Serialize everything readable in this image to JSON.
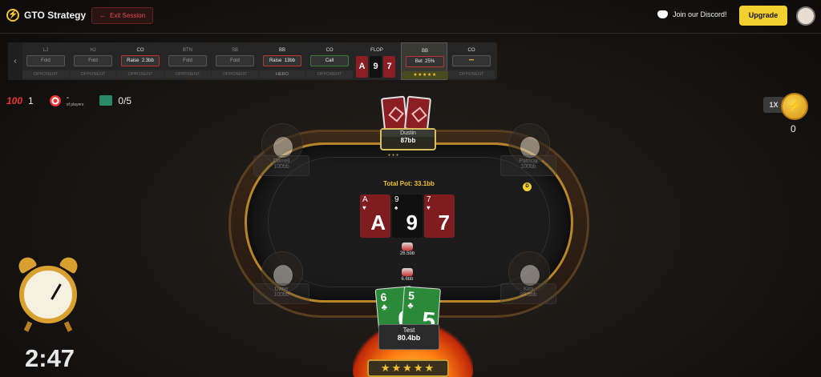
{
  "app": {
    "title": "GTO Strategy",
    "exit_label": "Exit Session",
    "discord_label": "Join our Discord!",
    "upgrade_label": "Upgrade",
    "accent_color": "#f2d030"
  },
  "timeline": {
    "columns": [
      {
        "pos": "LJ",
        "action": "Fold",
        "role": "OPPONENT"
      },
      {
        "pos": "HJ",
        "action": "Fold",
        "role": "OPPONENT"
      },
      {
        "pos": "CO",
        "action": "Raise",
        "amount": "2.3bb",
        "role": "OPPONENT"
      },
      {
        "pos": "BTN",
        "action": "Fold",
        "role": "OPPONENT"
      },
      {
        "pos": "SB",
        "action": "Fold",
        "role": "OPPONENT"
      },
      {
        "pos": "BB",
        "action": "Raise",
        "amount": "13bb",
        "role": "HERO"
      },
      {
        "pos": "CO",
        "action": "Call",
        "role": "OPPONENT"
      }
    ],
    "flop": {
      "label": "FLOP",
      "cards": [
        {
          "rank": "A",
          "suit": "♥"
        },
        {
          "rank": "9",
          "suit": "♠"
        },
        {
          "rank": "7",
          "suit": "♥"
        }
      ]
    },
    "selected": {
      "pos": "BB",
      "action": "Bet",
      "amount": "25%",
      "stars": "★★★★★"
    },
    "last": {
      "pos": "CO",
      "action": "•••",
      "role": "OPPONENT"
    }
  },
  "stats": {
    "score_icon": "100",
    "score": "1",
    "players_value": "-",
    "players_label": "of players",
    "hands": "0/5"
  },
  "coins": {
    "multiplier": "1X",
    "count": "0"
  },
  "table": {
    "pot_label": "Total Pot: 33.1bb",
    "board": [
      {
        "rank": "A",
        "suit": "♥",
        "color": "red"
      },
      {
        "rank": "9",
        "suit": "♠",
        "color": "black"
      },
      {
        "rank": "7",
        "suit": "♥",
        "color": "red"
      }
    ],
    "chips_top": "26.5bb",
    "chips_bottom": "6.6bb",
    "dealer": "D"
  },
  "seats": {
    "top": {
      "name": "Dustin",
      "stack": "87bb"
    },
    "top_left": {
      "name": "Darrell",
      "stack": "100bb"
    },
    "top_right": {
      "name": "Patricia",
      "stack": "100bb"
    },
    "bottom_left": {
      "name": "Dane",
      "stack": "100bb"
    },
    "bottom_right": {
      "name": "Kim",
      "stack": "99.5bb"
    }
  },
  "hero": {
    "name": "Test",
    "stack": "80.4bb",
    "cards": [
      {
        "rank": "6",
        "suit": "♣"
      },
      {
        "rank": "5",
        "suit": "♣"
      }
    ],
    "stars": "★★★★★"
  },
  "timer": {
    "value": "2:47"
  }
}
